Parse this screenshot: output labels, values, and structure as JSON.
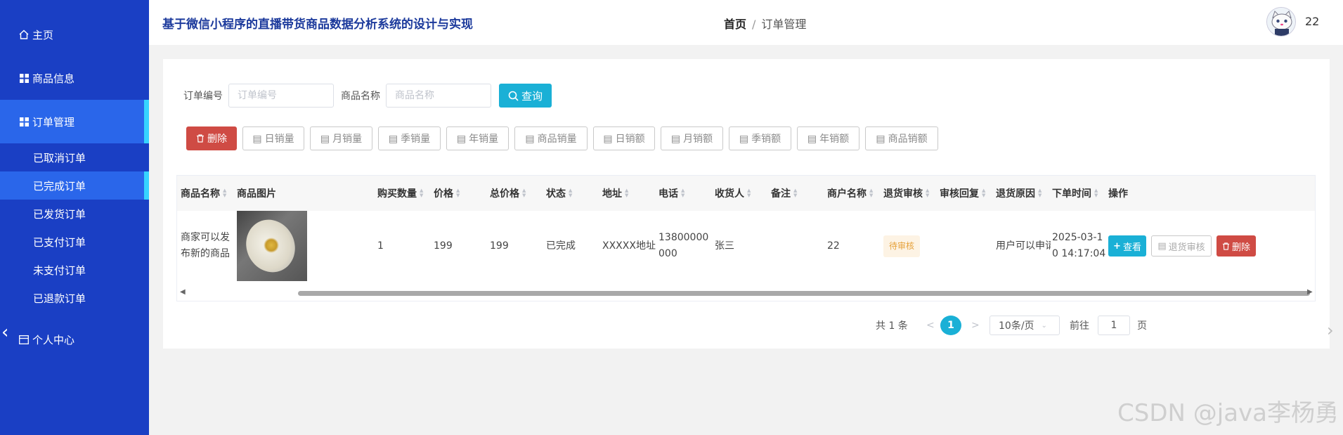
{
  "sidebar": {
    "top_items": [
      {
        "label": "主页",
        "icon": "home-icon"
      },
      {
        "label": "商品信息",
        "icon": "grid-icon"
      },
      {
        "label": "订单管理",
        "icon": "grid-icon"
      }
    ],
    "sub_items": [
      "已取消订单",
      "已完成订单",
      "已发货订单",
      "已支付订单",
      "未支付订单",
      "已退款订单"
    ],
    "bottom_item": {
      "label": "个人中心",
      "icon": "calendar-icon"
    },
    "colors": {
      "bg": "#1a3fc4",
      "active": "#2a66ea",
      "accent": "#36d4ff"
    }
  },
  "header": {
    "title": "基于微信小程序的直播带货商品数据分析系统的设计与实现",
    "breadcrumb_home": "首页",
    "breadcrumb_sep": "/",
    "breadcrumb_current": "订单管理",
    "username": "22"
  },
  "search": {
    "order_no_label": "订单编号",
    "order_no_placeholder": "订单编号",
    "product_name_label": "商品名称",
    "product_name_placeholder": "商品名称",
    "query_label": "查询"
  },
  "toolbar": {
    "delete_label": "删除",
    "buttons": [
      "日销量",
      "月销量",
      "季销量",
      "年销量",
      "商品销量",
      "日销额",
      "月销额",
      "季销额",
      "年销额",
      "商品销额"
    ]
  },
  "table": {
    "columns": [
      "商品名称",
      "商品图片",
      "购买数量",
      "价格",
      "总价格",
      "状态",
      "地址",
      "电话",
      "收货人",
      "备注",
      "商户名称",
      "退货审核",
      "审核回复",
      "退货原因",
      "下单时间",
      "操作"
    ],
    "rows": [
      {
        "product_name": "商家可以发布新的商品",
        "quantity": "1",
        "price": "199",
        "total": "199",
        "status": "已完成",
        "address": "XXXXX地址",
        "phone": "13800000000",
        "receiver": "张三",
        "remark": "",
        "merchant": "22",
        "return_review": "待审核",
        "review_reply": "",
        "return_reason": "用户可以申请",
        "order_time": "2025-03-10 14:17:04",
        "view_label": "查看",
        "review_label": "退货审核",
        "delete_label": "删除"
      }
    ]
  },
  "pagination": {
    "total_text": "共 1 条",
    "prev": "<",
    "current_page": "1",
    "next": ">",
    "page_size": "10条/页",
    "goto_label": "前往",
    "goto_value": "1",
    "page_suffix": "页"
  },
  "watermark": "CSDN @java李杨勇"
}
